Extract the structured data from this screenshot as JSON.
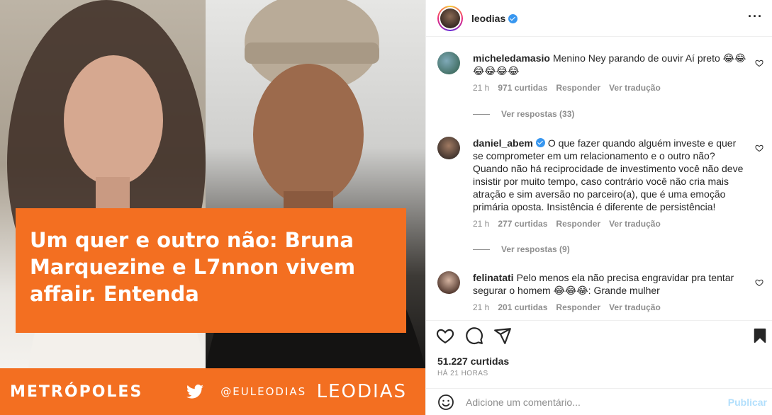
{
  "post_image": {
    "headline": "Um quer e outro não: Bruna Marquezine e L7nnon vivem affair. Entenda",
    "brand_name": "METRÓPOLES",
    "brand_handle": "@EULEODIAS",
    "brand_signature": "LEODIAS"
  },
  "header": {
    "username": "leodias",
    "more_label": "···"
  },
  "comments": [
    {
      "user": "micheledamasio",
      "verified": false,
      "text": "Menino Ney parando de ouvir Aí preto 😂😂😂😂😂😂",
      "time": "21 h",
      "likes": "971 curtidas",
      "reply": "Responder",
      "translate": "Ver tradução",
      "replies": "Ver respostas (33)"
    },
    {
      "user": "daniel_abem",
      "verified": true,
      "text": "O que fazer quando alguém investe e quer se comprometer em um relacionamento e o outro não? Quando não há reciprocidade de investimento você não deve insistir por muito tempo, caso contrário você não cria mais atração e sim aversão no parceiro(a), que é uma emoção primária oposta. Insistência é diferente de persistência!",
      "time": "21 h",
      "likes": "277 curtidas",
      "reply": "Responder",
      "translate": "Ver tradução",
      "replies": "Ver respostas (9)"
    },
    {
      "user": "felinatati",
      "verified": false,
      "text": "Pelo menos ela não precisa engravidar pra tentar segurar o homem 😂😂😂: Grande mulher",
      "time": "21 h",
      "likes": "201 curtidas",
      "reply": "Responder",
      "translate": "Ver tradução"
    }
  ],
  "stats": {
    "likes": "51.227 curtidas",
    "time_ago": "HÁ 21 HORAS"
  },
  "comment_box": {
    "placeholder": "Adicione um comentário...",
    "publish_label": "Publicar"
  },
  "colors": {
    "brand_orange": "#f36f21",
    "verified_blue": "#3897f0",
    "publish_disabled": "#b2dffc"
  }
}
